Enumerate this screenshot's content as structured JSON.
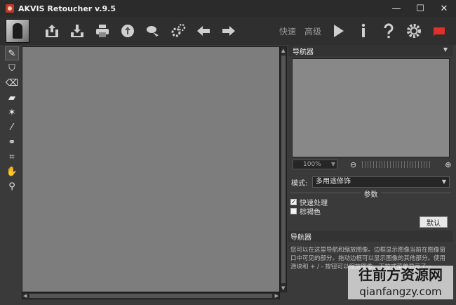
{
  "window": {
    "title": "AKVIS Retoucher v.9.5",
    "controls": [
      "—",
      "☐",
      "✕"
    ]
  },
  "toolbar": {
    "left_icons": [
      "open-image-icon",
      "save-image-icon",
      "print-icon",
      "share-icon",
      "batch-icon",
      "plugins-icon",
      "undo-arrow-icon",
      "redo-arrow-icon"
    ],
    "mode_fast": "快速",
    "mode_advanced": "高级",
    "right_icons": [
      "run-icon",
      "info-icon",
      "help-icon",
      "settings-icon",
      "news-icon"
    ]
  },
  "tools": [
    "retouch-brush-icon",
    "stamp-icon",
    "eraser-icon",
    "patch-icon",
    "magic-wand-icon",
    "smart-brush-icon",
    "clone-icon",
    "crop-icon",
    "hand-icon",
    "zoom-icon"
  ],
  "navigator": {
    "title": "导航器",
    "zoom_value": "100%"
  },
  "settings": {
    "mode_label": "模式:",
    "mode_value": "多用途修饰",
    "params_title": "参数",
    "option1_label": "快速处理",
    "option1_checked": true,
    "option2_label": "棕褐色",
    "option2_checked": false,
    "default_button": "默认"
  },
  "help": {
    "title": "导航器",
    "text": "您可以在这里导航和缩放图像。边框显示图像当前在图像窗口中可见的部分。拖动边框可以显示图像的其他部分。使用滑块和 + / - 按钮可以缩放图像。下拉式菜单显示了一"
  },
  "watermark": {
    "line1": "往前方资源网",
    "line2": "qianfangzy.com"
  },
  "colors": {
    "window_bg": "#3a3a3a",
    "canvas": "#7d7d7d",
    "accent_red": "#e0302a"
  }
}
